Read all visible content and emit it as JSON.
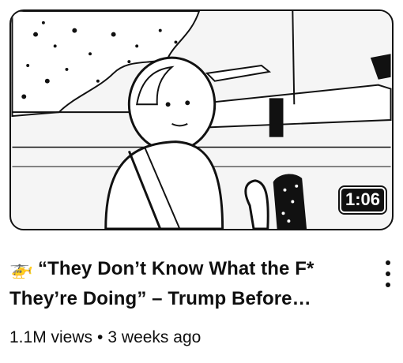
{
  "video": {
    "title_icon": "🚁",
    "title": "“They Don’t Know What the F* They’re Doing” – Trump Before…",
    "duration": "1:06",
    "views": "1.1M views",
    "separator": "•",
    "age": "3 weeks ago"
  },
  "icons": {
    "menu": "more-vert-icon",
    "title_icon": "helicopter-icon"
  }
}
